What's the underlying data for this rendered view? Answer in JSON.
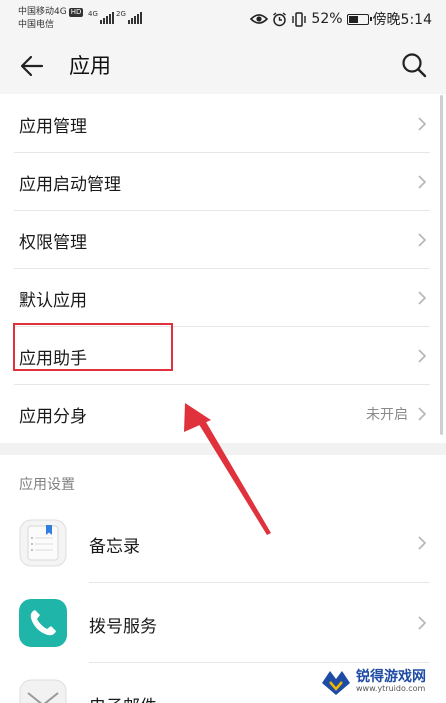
{
  "status_bar": {
    "carrier_1": "中国移动4G",
    "carrier_1_badge": "HD",
    "carrier_2": "中国电信",
    "signal_1_label": "4G",
    "signal_2_label": "2G",
    "battery_text": "52%",
    "battery_level": 0.52,
    "time": "傍晚5:14"
  },
  "header": {
    "title": "应用"
  },
  "menu": {
    "items": [
      {
        "label": "应用管理"
      },
      {
        "label": "应用启动管理"
      },
      {
        "label": "权限管理"
      },
      {
        "label": "默认应用"
      },
      {
        "label": "应用助手"
      },
      {
        "label": "应用分身",
        "value": "未开启"
      }
    ]
  },
  "app_settings": {
    "section_title": "应用设置",
    "apps": [
      {
        "label": "备忘录",
        "icon": "memo-icon"
      },
      {
        "label": "拨号服务",
        "icon": "phone-icon"
      },
      {
        "label": "电子邮件",
        "icon": "email-icon"
      }
    ]
  },
  "watermark": {
    "main": "锐得游戏网",
    "sub": "www.ytruido.com"
  },
  "colors": {
    "highlight": "#e0323c",
    "phone_icon": "#1fb5a8",
    "memo_bookmark": "#2f7ee0"
  }
}
